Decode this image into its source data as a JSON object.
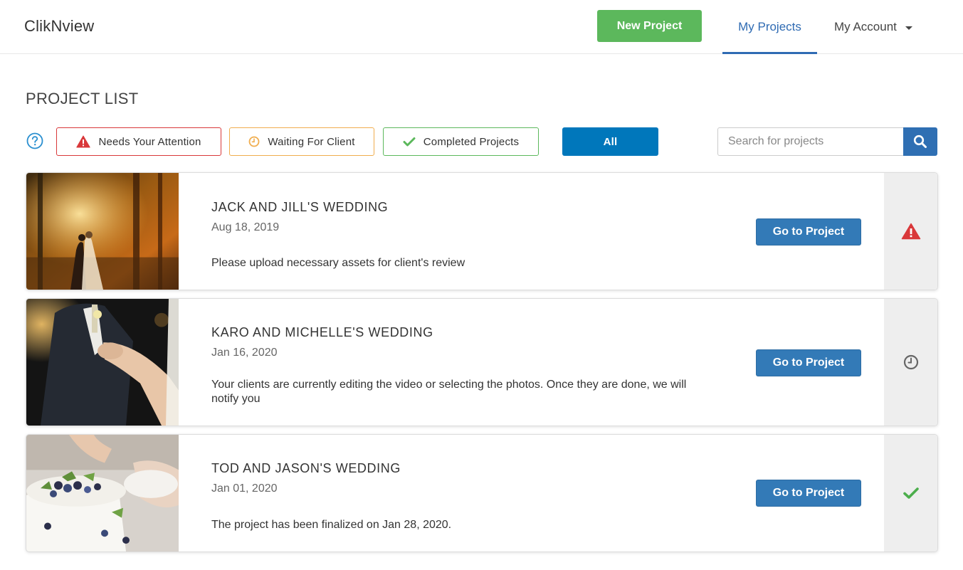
{
  "header": {
    "brand": "ClikNview",
    "new_project_label": "New Project",
    "nav_my_projects": "My Projects",
    "nav_my_account": "My Account"
  },
  "page": {
    "title": "PROJECT LIST"
  },
  "filters": {
    "help_icon": "question-circle-icon",
    "needs_attention": {
      "label": "Needs Your Attention",
      "icon": "warning-triangle-icon",
      "color": "#d9383a"
    },
    "waiting_for_client": {
      "label": "Waiting For Client",
      "icon": "clock-icon",
      "color": "#f0ad4e"
    },
    "completed": {
      "label": "Completed Projects",
      "icon": "checkmark-icon",
      "color": "#5cb85c"
    },
    "all": {
      "label": "All",
      "selected": true,
      "color": "#0077bb"
    }
  },
  "search": {
    "placeholder": "Search for projects",
    "value": "",
    "icon": "search-icon"
  },
  "projects": [
    {
      "title": "JACK AND JILL'S WEDDING",
      "date": "Aug 18, 2019",
      "message": "Please upload necessary assets for client's review",
      "button_label": "Go to Project",
      "status": "needs-attention",
      "status_icon": "warning-triangle-icon",
      "status_color": "#d9383a"
    },
    {
      "title": "KARO AND MICHELLE'S WEDDING",
      "date": "Jan 16, 2020",
      "message": "Your clients are currently editing the video or selecting the photos. Once they are done, we will notify you",
      "button_label": "Go to Project",
      "status": "waiting-for-client",
      "status_icon": "clock-icon",
      "status_color": "#666666"
    },
    {
      "title": "TOD AND JASON'S WEDDING",
      "date": "Jan 01, 2020",
      "message": "The project has been finalized on Jan 28, 2020.",
      "button_label": "Go to Project",
      "status": "completed",
      "status_icon": "checkmark-icon",
      "status_color": "#4cae4c"
    }
  ],
  "colors": {
    "primary": "#337ab7",
    "nav_active": "#2f6bb3",
    "success": "#5cb85c",
    "status_column_bg": "#eeeeee"
  }
}
